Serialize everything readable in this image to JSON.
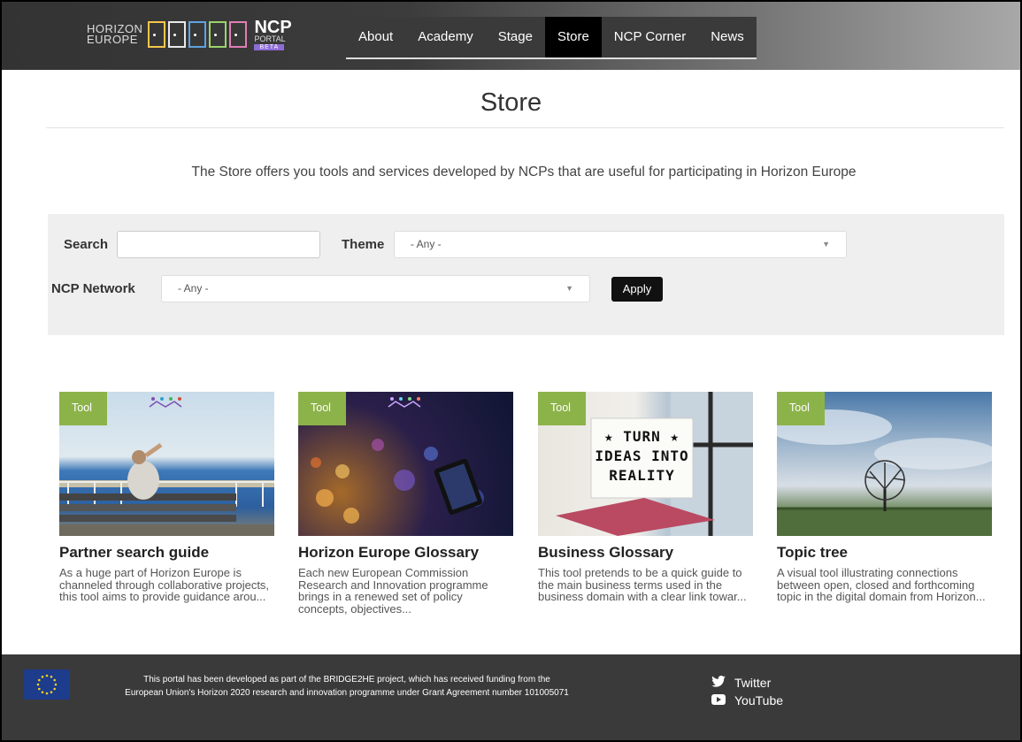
{
  "header": {
    "logo": {
      "line1": "HORIZON",
      "line2": "EUROPE",
      "ncp": "NCP",
      "portal": "PORTAL",
      "beta": "BETA"
    },
    "nav": [
      {
        "label": "About"
      },
      {
        "label": "Academy"
      },
      {
        "label": "Stage"
      },
      {
        "label": "Store",
        "active": true
      },
      {
        "label": "NCP Corner"
      },
      {
        "label": "News"
      }
    ]
  },
  "page": {
    "title": "Store",
    "intro": "The Store offers you tools and services developed by NCPs that are useful for participating in Horizon Europe"
  },
  "filters": {
    "search_label": "Search",
    "search_value": "",
    "theme_label": "Theme",
    "theme_value": "- Any -",
    "network_label": "NCP Network",
    "network_value": "- Any -",
    "apply_label": "Apply"
  },
  "cards": [
    {
      "tag": "Tool",
      "title": "Partner search guide",
      "desc": "As a huge part of Horizon Europe is channeled through collaborative projects, this tool aims to provide guidance arou..."
    },
    {
      "tag": "Tool",
      "title": "Horizon Europe Glossary",
      "desc": "Each new European Commission Research and Innovation programme brings in a renewed set of policy concepts, objectives..."
    },
    {
      "tag": "Tool",
      "title": "Business Glossary",
      "desc": "This tool pretends to be a quick guide to the main business terms used in the business domain with a clear link towar...",
      "image_text": [
        "★ TURN ★",
        "IDEAS INTO",
        "REALITY"
      ]
    },
    {
      "tag": "Tool",
      "title": "Topic tree",
      "desc": "A visual tool illustrating connections between open, closed and forthcoming topic in the digital domain from Horizon..."
    }
  ],
  "footer": {
    "text_line1": "This portal has been developed as part of the BRIDGE2HE project, which has received funding from the",
    "text_line2": "European Union's Horizon 2020 research and innovation programme under Grant Agreement number 101005071",
    "links": [
      {
        "label": "Twitter",
        "icon": "twitter-icon"
      },
      {
        "label": "YouTube",
        "icon": "youtube-icon"
      }
    ]
  },
  "colors": {
    "tag_green": "#8cb34a",
    "nav_active": "#000000",
    "footer_bg": "#3a3a3a",
    "eu_blue": "#1e3c8c",
    "beta_purple": "#8e6cd6"
  }
}
